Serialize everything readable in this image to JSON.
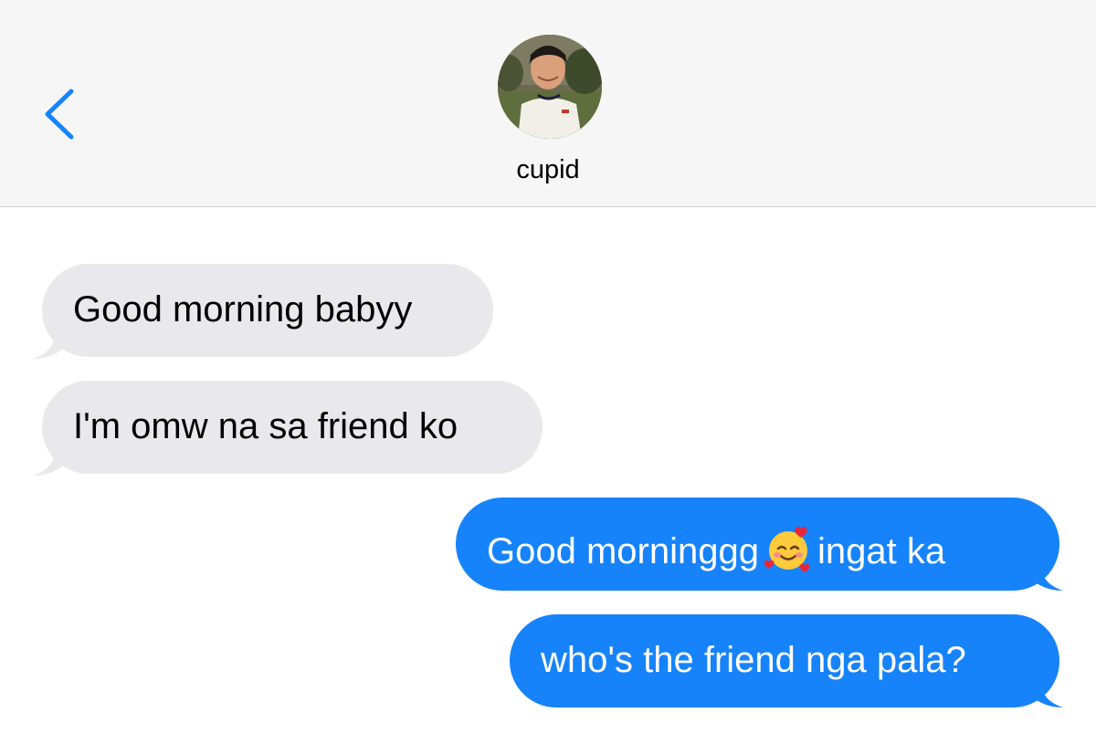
{
  "header": {
    "back_icon": "chevron-left-icon",
    "contact_name": "cupid",
    "accent_color": "#1683fb"
  },
  "messages": [
    {
      "direction": "incoming",
      "text": "Good morning babyy"
    },
    {
      "direction": "incoming",
      "text": "I'm omw na sa friend ko"
    },
    {
      "direction": "outgoing",
      "text_before": "Good morninggg",
      "emoji": "smiling-face-with-hearts-icon",
      "text_after": "ingat ka"
    },
    {
      "direction": "outgoing",
      "text": "who's the friend nga pala?"
    }
  ],
  "colors": {
    "incoming_bubble": "#e9e9eb",
    "outgoing_bubble": "#1683fb",
    "header_bg": "#f6f6f6"
  }
}
